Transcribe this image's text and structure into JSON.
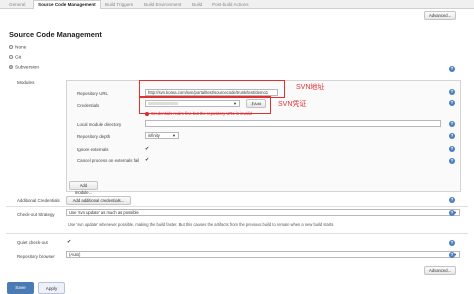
{
  "tabs": [
    {
      "label": "General"
    },
    {
      "label": "Source Code Management"
    },
    {
      "label": "Build Triggers"
    },
    {
      "label": "Build Environment"
    },
    {
      "label": "Build"
    },
    {
      "label": "Post-build Actions"
    }
  ],
  "top_advanced_label": "Advanced...",
  "section_title": "Source Code Management",
  "scm_options": [
    {
      "label": "None",
      "selected": false
    },
    {
      "label": "Git",
      "selected": false
    },
    {
      "label": "Subversion",
      "selected": true
    }
  ],
  "modules": {
    "label": "Modules",
    "repository_url_label": "Repository URL",
    "repository_url_value": "http://svn.korea.com/svn/portal/test/sourcecode/trunk/test/demo1",
    "credentials_label": "Credentials",
    "credentials_value": "",
    "add_label": "Add",
    "error_text": "Credentials realm fine but the repository URL is invalid",
    "local_dir_label": "Local module directory",
    "local_dir_value": "",
    "depth_label": "Repository depth",
    "depth_value": "infinity",
    "ignore_externals_label": "Ignore externals",
    "ignore_externals_checked": true,
    "cancel_externals_label": "Cancel process on externals fail",
    "cancel_externals_checked": true,
    "add_module_label": "Add module..."
  },
  "annotations": {
    "svn_address": "SVN地址",
    "svn_credentials": "SVN凭证"
  },
  "additional_credentials": {
    "label": "Additional Credentials",
    "button_label": "Add additional credentials..."
  },
  "checkout_strategy": {
    "label": "Check-out Strategy",
    "value": "Use 'svn update' as much as possible",
    "description": "Use 'svn update' whenever possible, making the build faster. But this causes the artifacts from the previous build to remain when a new build starts."
  },
  "quiet_checkout": {
    "label": "Quiet check-out",
    "checked": true
  },
  "repository_browser": {
    "label": "Repository browser",
    "value": "(Auto)"
  },
  "bottom_advanced_label": "Advanced...",
  "footer": {
    "save_label": "Save",
    "apply_label": "Apply"
  },
  "colors": {
    "accent": "#4b7bb5",
    "annotation": "#e03030",
    "error": "#dd2233"
  }
}
